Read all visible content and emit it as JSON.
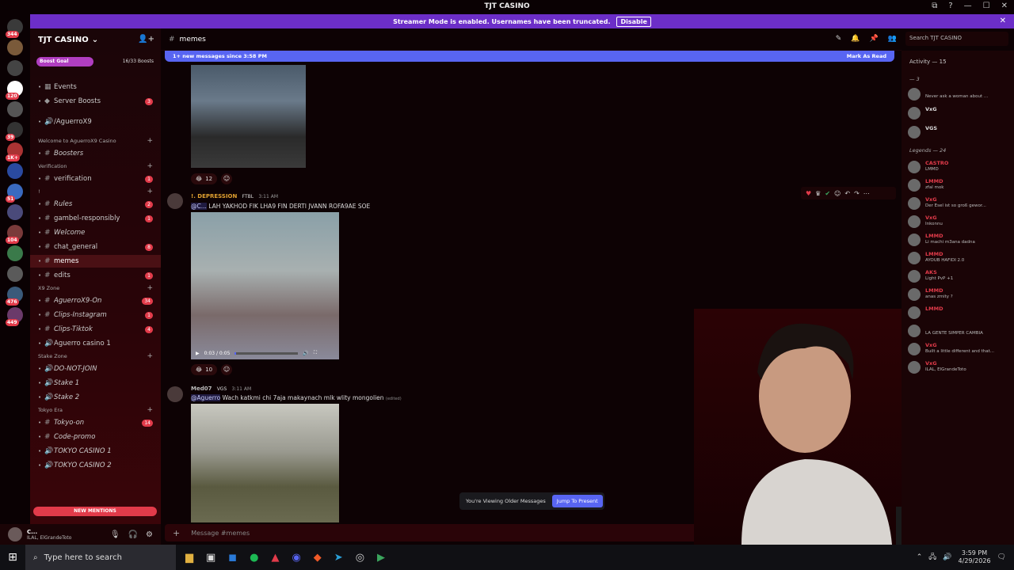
{
  "window": {
    "title": "TJT CASINO",
    "buttons": [
      "⧉",
      "?",
      "—",
      "☐",
      "✕"
    ]
  },
  "streamer": {
    "text": "Streamer Mode is enabled. Usernames have been truncated.",
    "disable": "Disable",
    "close": "✕"
  },
  "servers": [
    {
      "badge": "344",
      "color": "#3a3a3a"
    },
    {
      "badge": "",
      "color": "#7a5a3a"
    },
    {
      "badge": "",
      "color": "#444"
    },
    {
      "badge": "120",
      "color": "#ffffff"
    },
    {
      "badge": "",
      "color": "#555"
    },
    {
      "badge": "39",
      "color": "#333"
    },
    {
      "badge": "1K+",
      "color": "#a33"
    },
    {
      "badge": "",
      "color": "#2a4aa0"
    },
    {
      "badge": "51",
      "color": "#3a6ac0"
    },
    {
      "badge": "",
      "color": "#4a4a7a"
    },
    {
      "badge": "104",
      "color": "#7a3a3a"
    },
    {
      "badge": "",
      "color": "#3a7a4a"
    },
    {
      "badge": "",
      "color": "#5a5a5a"
    },
    {
      "badge": "476",
      "color": "#3a5a7a"
    },
    {
      "badge": "449",
      "color": "#6a3a6a"
    }
  ],
  "guild": {
    "name": "TJT CASINO",
    "chevron": "⌄",
    "invite_icon": "👤+",
    "boost_label": "Boost Goal",
    "boost_count": "16/33 Boosts"
  },
  "channels": [
    {
      "label": "Events",
      "kind": "item",
      "icon": "▦",
      "num": ""
    },
    {
      "label": "Server Boosts",
      "kind": "item",
      "icon": "◆",
      "num": "3"
    },
    {
      "label": "/AguerroX9",
      "kind": "item",
      "icon": "🔊",
      "num": ""
    },
    {
      "label": "Welcome to AguerroX9 Casino",
      "kind": "cat",
      "icon": "",
      "num": ""
    },
    {
      "label": "Boosters",
      "kind": "item",
      "icon": "#",
      "num": "",
      "italic": true
    },
    {
      "label": "Verification",
      "kind": "cat",
      "icon": "",
      "num": ""
    },
    {
      "label": "verification",
      "kind": "item",
      "icon": "#",
      "num": "1"
    },
    {
      "label": "!",
      "kind": "cat",
      "icon": "",
      "num": ""
    },
    {
      "label": "Rules",
      "kind": "item",
      "icon": "#",
      "num": "2",
      "italic": true
    },
    {
      "label": "gambel-responsibly",
      "kind": "item",
      "icon": "#",
      "num": "1"
    },
    {
      "label": "Welcome",
      "kind": "item",
      "icon": "#",
      "num": "",
      "italic": true
    },
    {
      "label": "chat_general",
      "kind": "item",
      "icon": "#",
      "num": "8"
    },
    {
      "label": "memes",
      "kind": "item",
      "icon": "#",
      "num": "",
      "active": true
    },
    {
      "label": "edits",
      "kind": "item",
      "icon": "#",
      "num": "1"
    },
    {
      "label": "X9 Zone",
      "kind": "cat",
      "icon": "",
      "num": ""
    },
    {
      "label": "AguerroX9-On",
      "kind": "item",
      "icon": "#",
      "num": "34",
      "italic": true
    },
    {
      "label": "Clips-Instagram",
      "kind": "item",
      "icon": "#",
      "num": "1",
      "italic": true
    },
    {
      "label": "Clips-Tiktok",
      "kind": "item",
      "icon": "#",
      "num": "4",
      "italic": true
    },
    {
      "label": "Aguerro casino 1",
      "kind": "item",
      "icon": "🔊",
      "num": ""
    },
    {
      "label": "Stake Zone",
      "kind": "cat",
      "icon": "",
      "num": ""
    },
    {
      "label": "DO-NOT-JOIN",
      "kind": "item",
      "icon": "🔊",
      "num": "",
      "italic": true
    },
    {
      "label": "Stake 1",
      "kind": "item",
      "icon": "🔊",
      "num": "",
      "italic": true
    },
    {
      "label": "Stake 2",
      "kind": "item",
      "icon": "🔊",
      "num": "",
      "italic": true
    },
    {
      "label": "Tokyo Era",
      "kind": "cat",
      "icon": "",
      "num": ""
    },
    {
      "label": "Tokyo-on",
      "kind": "item",
      "icon": "#",
      "num": "14",
      "italic": true
    },
    {
      "label": "Code-promo",
      "kind": "item",
      "icon": "#",
      "num": "",
      "italic": true
    },
    {
      "label": "TOKYO CASINO 1",
      "kind": "item",
      "icon": "🔊",
      "num": "",
      "italic": true
    },
    {
      "label": "TOKYO CASINO 2",
      "kind": "item",
      "icon": "🔊",
      "num": "",
      "italic": true
    }
  ],
  "new_mentions": "NEW MENTIONS",
  "user": {
    "name": "C...",
    "status": "ILAL, ElGrandeToto"
  },
  "chat": {
    "channel": "memes",
    "new_messages": "1+ new messages since 3:58 PM",
    "mark_read": "Mark As Read",
    "search_placeholder": "Search TJT CASINO"
  },
  "messages": [
    {
      "reaction_count": "12"
    },
    {
      "author": "!. DEPRESSION",
      "tag": "FTBL",
      "time": "3:11 AM",
      "mention": "@C...",
      "text": "LAH YAKHOD FIK LHA9 FIN DERTI JVANN ROFA9AE SOE",
      "video_time": "0:03 / 0:05",
      "reaction_count": "10"
    },
    {
      "author": "Med07",
      "tag": "VGS",
      "time": "3:11 AM",
      "mention": "@Aguerro",
      "text": "Wach katkmi chi 7aja makaynach mlk wlity mongolien",
      "edited": "(edited)"
    }
  ],
  "older": {
    "text": "You're Viewing Older Messages",
    "jump": "Jump To Present"
  },
  "composer": {
    "placeholder": "Message #memes"
  },
  "activity": {
    "title": "Activity — 15",
    "group1": "— 3",
    "group2": "Legends — 24",
    "members": [
      {
        "name": "",
        "status": "Never ask a woman about ...",
        "color": "#ddd"
      },
      {
        "name": "VxG",
        "status": "",
        "color": "#ddd"
      },
      {
        "name": "VGS",
        "status": "",
        "color": "#ddd"
      },
      {
        "name": "CASTRO",
        "status": "LMMD",
        "color": "#e23b4a"
      },
      {
        "name": "LMMD",
        "status": "zfal mok",
        "color": "#e23b4a"
      },
      {
        "name": "VxG",
        "status": "Der Esel ist so groß gewor...",
        "color": "#e23b4a"
      },
      {
        "name": "VxG",
        "status": "Inkonnu",
        "color": "#e23b4a"
      },
      {
        "name": "LMMD",
        "status": "Li machi m3ana dadna",
        "color": "#e23b4a"
      },
      {
        "name": "LMMD",
        "status": "AYOUB HAFIDI 2.0",
        "color": "#e23b4a"
      },
      {
        "name": "AKS",
        "status": "Light PvP +1",
        "color": "#e23b4a"
      },
      {
        "name": "LMMD",
        "status": "anas zmity ?",
        "color": "#e23b4a"
      },
      {
        "name": "LMMD",
        "status": "",
        "color": "#e23b4a"
      },
      {
        "name": "",
        "status": "LA GENTE SIMPER CAMBIA",
        "color": "#e23b4a"
      },
      {
        "name": "VxG",
        "status": "Built a little different and that...",
        "color": "#e23b4a"
      },
      {
        "name": "VxG",
        "status": "ILAL, ElGrandeToto",
        "color": "#e23b4a"
      }
    ]
  },
  "taskbar": {
    "search": "Type here to search",
    "time": "3:59 PM",
    "date": "4/29/2026"
  }
}
